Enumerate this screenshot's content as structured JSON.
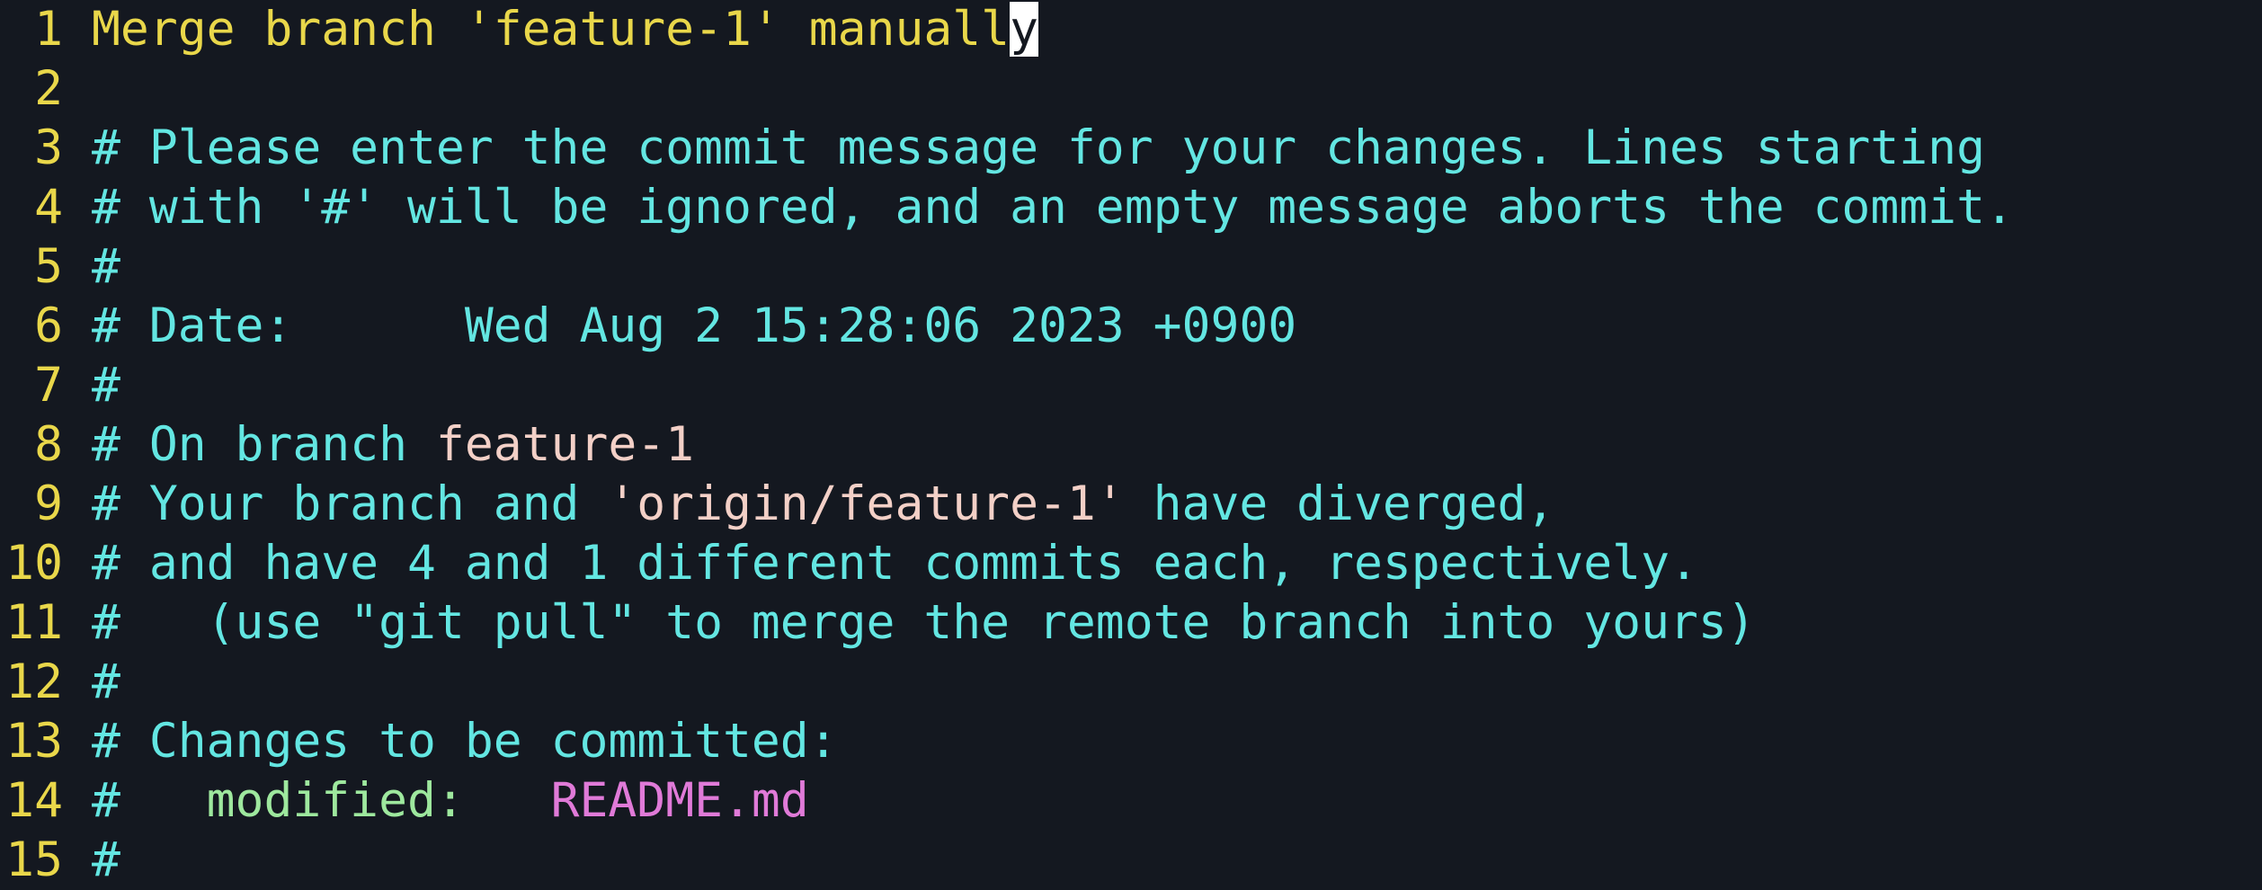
{
  "editor": {
    "lines": [
      {
        "num": "1",
        "msg_before_cursor": "Merge branch 'feature-1' manuall",
        "cursor_char": "y"
      },
      {
        "num": "2"
      },
      {
        "num": "3",
        "text": "# Please enter the commit message for your changes. Lines starting"
      },
      {
        "num": "4",
        "text": "# with '#' will be ignored, and an empty message aborts the commit."
      },
      {
        "num": "5",
        "text": "#"
      },
      {
        "num": "6",
        "text": "# Date:      Wed Aug 2 15:28:06 2023 +0900"
      },
      {
        "num": "7",
        "text": "#"
      },
      {
        "num": "8",
        "prefix": "# On branch ",
        "branch": "feature-1"
      },
      {
        "num": "9",
        "prefix": "# Your branch and ",
        "branch": "'origin/feature-1'",
        "suffix": " have diverged,"
      },
      {
        "num": "10",
        "text": "# and have 4 and 1 different commits each, respectively."
      },
      {
        "num": "11",
        "text": "#   (use \"git pull\" to merge the remote branch into yours)"
      },
      {
        "num": "12",
        "text": "#"
      },
      {
        "num": "13",
        "text": "# Changes to be committed:"
      },
      {
        "num": "14",
        "prefix": "#   ",
        "status": "modified:",
        "spacer": "   ",
        "file": "README.md"
      },
      {
        "num": "15",
        "text": "#"
      }
    ]
  },
  "colors": {
    "background": "#141820",
    "line_number": "#e9d74a",
    "commit_message": "#e9d74a",
    "comment": "#63e6e2",
    "branch_name": "#f3d0c7",
    "modified_status": "#9ee89e",
    "file_name": "#e07ad8",
    "cursor_bg": "#ffffff"
  }
}
